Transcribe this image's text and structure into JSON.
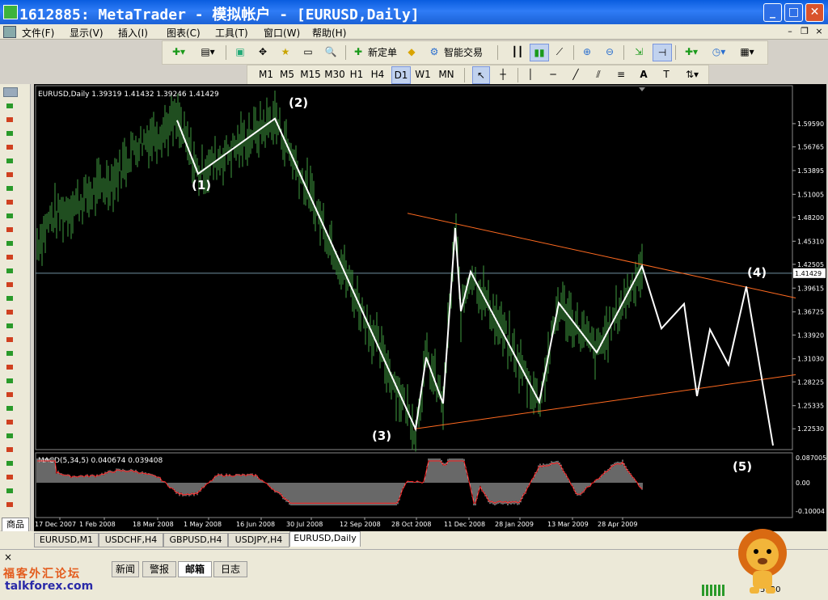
{
  "window": {
    "title": "1612885: MetaTrader - 模拟帐户 - [EURUSD,Daily]",
    "minimize": "_",
    "maximize": "□",
    "close": "✕"
  },
  "menu": [
    "文件(F)",
    "显示(V)",
    "插入(I)",
    "图表(C)",
    "工具(T)",
    "窗口(W)",
    "帮助(H)"
  ],
  "toolbar": {
    "new_order": "新定单",
    "expert_advisors": "智能交易",
    "timeframes": [
      "M1",
      "M5",
      "M15",
      "M30",
      "H1",
      "H4",
      "D1",
      "W1",
      "MN"
    ],
    "selected_timeframe": "D1"
  },
  "chart": {
    "header": "EURUSD,Daily  1.39319 1.41432 1.39246 1.41429",
    "current_price": "1.41429",
    "macd_header": "MACD(5,34,5) 0.040674 0.039408",
    "colors": {
      "bars": "#3f9b3f",
      "trendline": "#ff6a20",
      "wave": "#ffffff",
      "macd_signal": "#ff2222",
      "price_line": "#6f8f9f"
    }
  },
  "chart_data": {
    "type": "line",
    "symbol": "EURUSD",
    "timeframe": "Daily",
    "price_axis_labels": [
      "1.59590",
      "1.56765",
      "1.53895",
      "1.51005",
      "1.48200",
      "1.45310",
      "1.42505",
      "1.39615",
      "1.36725",
      "1.33920",
      "1.31030",
      "1.28225",
      "1.25335",
      "1.22530"
    ],
    "time_axis_labels": [
      "17 Dec 2007",
      "1 Feb 2008",
      "18 Mar 2008",
      "1 May 2008",
      "16 Jun 2008",
      "30 Jul 2008",
      "12 Sep 2008",
      "28 Oct 2008",
      "11 Dec 2008",
      "28 Jan 2009",
      "13 Mar 2009",
      "28 Apr 2009"
    ],
    "macd_axis_labels": [
      "0.087005",
      "0.00",
      "-0.10004"
    ],
    "wave_labels": [
      "(1)",
      "(2)",
      "(3)",
      "(4)",
      "(5)"
    ],
    "elliott_path_prices": [
      1.6,
      1.535,
      1.602,
      1.225,
      1.312,
      1.256,
      1.469,
      1.368,
      1.416,
      1.258,
      1.378,
      1.318,
      1.423,
      1.347,
      1.377,
      1.265,
      1.346,
      1.303,
      1.398,
      1.205
    ],
    "triangle_upper_prices": [
      1.487,
      1.392
    ],
    "triangle_lower_prices": [
      1.225,
      1.289
    ],
    "last_close": 1.41429
  },
  "tabs": [
    "EURUSD,M1",
    "USDCHF,H4",
    "GBPUSD,H4",
    "USDJPY,H4",
    "EURUSD,Daily"
  ],
  "active_tab": "EURUSD,Daily",
  "side_tab": "商品",
  "bottom_tabs": [
    "新闻",
    "警报",
    "邮箱",
    "日志"
  ],
  "active_bottom_tab": "邮箱",
  "watermark": {
    "line1": "福客外汇论坛",
    "line2": "talkforex.com"
  },
  "status_text": "5520"
}
